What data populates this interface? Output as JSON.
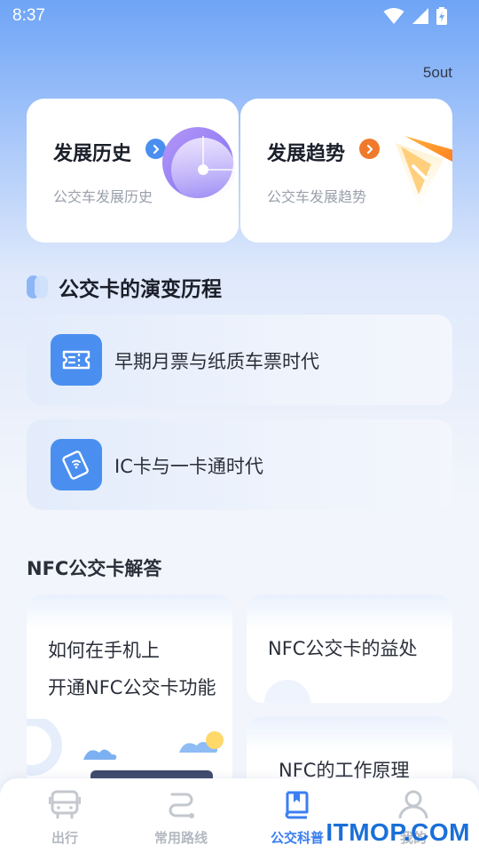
{
  "status_bar": {
    "time": "8:37",
    "icons": [
      "wifi-icon",
      "signal-icon",
      "battery-charging-icon"
    ]
  },
  "header": {
    "top_right_link": "5out"
  },
  "hero_cards": [
    {
      "title": "发展历史",
      "subtitle": "公交车发展历史",
      "arrow_color": "#4a8ff0",
      "icon": "chevron-right-icon"
    },
    {
      "title": "发展趋势",
      "subtitle": "公交车发展趋势",
      "arrow_color": "#f07a2c",
      "icon": "chevron-right-icon"
    }
  ],
  "evolution_section": {
    "title": "公交卡的演变历程",
    "items": [
      {
        "label": "早期月票与纸质车票时代",
        "icon": "ticket-icon"
      },
      {
        "label": "IC卡与一卡通时代",
        "icon": "nfc-card-icon"
      }
    ]
  },
  "nfc_section": {
    "title": "NFC公交卡解答",
    "cards": [
      {
        "line1": "如何在手机上",
        "line2": "开通NFC公交卡功能"
      },
      {
        "line1": "NFC公交卡的益处"
      },
      {
        "line1": "NFC的工作原理"
      }
    ]
  },
  "tabbar": {
    "active": "公交科普",
    "active_color": "#3b7ff2",
    "tabs": [
      {
        "label": "出行",
        "icon": "bus-icon"
      },
      {
        "label": "常用路线",
        "icon": "route-icon"
      },
      {
        "label": "公交科普",
        "icon": "book-icon"
      },
      {
        "label": "我的",
        "icon": "user-icon"
      }
    ]
  },
  "watermark": "ITMOP.COM"
}
